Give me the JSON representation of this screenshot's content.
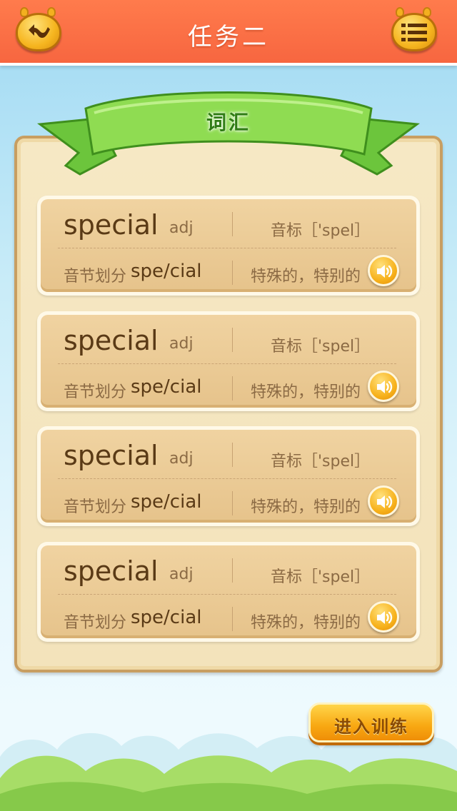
{
  "header": {
    "title": "任务二",
    "back_icon": "back-arrow-icon",
    "menu_icon": "menu-list-icon",
    "color": "#f76640"
  },
  "section": {
    "title": "词汇"
  },
  "words": [
    {
      "word": "special",
      "pos": "adj",
      "phonetic": "音标［'spel］",
      "syllable_label": "音节划分",
      "syllable": "spe/cial",
      "meaning": "特殊的，特别的",
      "audio_icon": "speaker-icon"
    },
    {
      "word": "special",
      "pos": "adj",
      "phonetic": "音标［'spel］",
      "syllable_label": "音节划分",
      "syllable": "spe/cial",
      "meaning": "特殊的，特别的",
      "audio_icon": "speaker-icon"
    },
    {
      "word": "special",
      "pos": "adj",
      "phonetic": "音标［'spel］",
      "syllable_label": "音节划分",
      "syllable": "spe/cial",
      "meaning": "特殊的，特别的",
      "audio_icon": "speaker-icon"
    },
    {
      "word": "special",
      "pos": "adj",
      "phonetic": "音标［'spel］",
      "syllable_label": "音节划分",
      "syllable": "spe/cial",
      "meaning": "特殊的，特别的",
      "audio_icon": "speaker-icon"
    }
  ],
  "actions": {
    "start_training_label": "进入训练",
    "accent_color": "#f8a812"
  }
}
